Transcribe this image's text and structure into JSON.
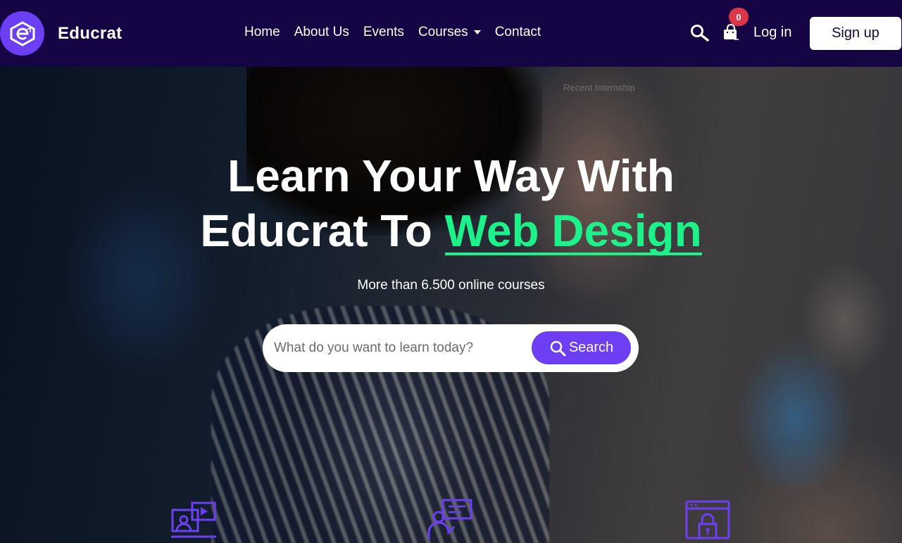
{
  "brand": {
    "name": "Educrat",
    "color": "#6c3ef4"
  },
  "nav": {
    "items": [
      {
        "label": "Home"
      },
      {
        "label": "About Us"
      },
      {
        "label": "Events"
      },
      {
        "label": "Courses",
        "dropdown": true
      },
      {
        "label": "Contact"
      }
    ]
  },
  "header_actions": {
    "search_icon": "search-icon",
    "cart_icon": "shopping-bag-icon",
    "cart_count": "0",
    "login_label": "Log in",
    "signup_label": "Sign up"
  },
  "hero": {
    "watermark": "Recent Internship",
    "headline_line1": "Learn Your Way With",
    "headline_line2_prefix": "Educrat To ",
    "headline_highlight": "Web Design",
    "highlight_color": "#1df28a",
    "subtitle": "More than 6.500 online courses",
    "search_placeholder": "What do you want to learn today?",
    "search_button": "Search"
  },
  "features": [
    {
      "icon": "online-video-course-icon"
    },
    {
      "icon": "expert-instructor-icon"
    },
    {
      "icon": "secure-lifetime-access-icon"
    }
  ]
}
